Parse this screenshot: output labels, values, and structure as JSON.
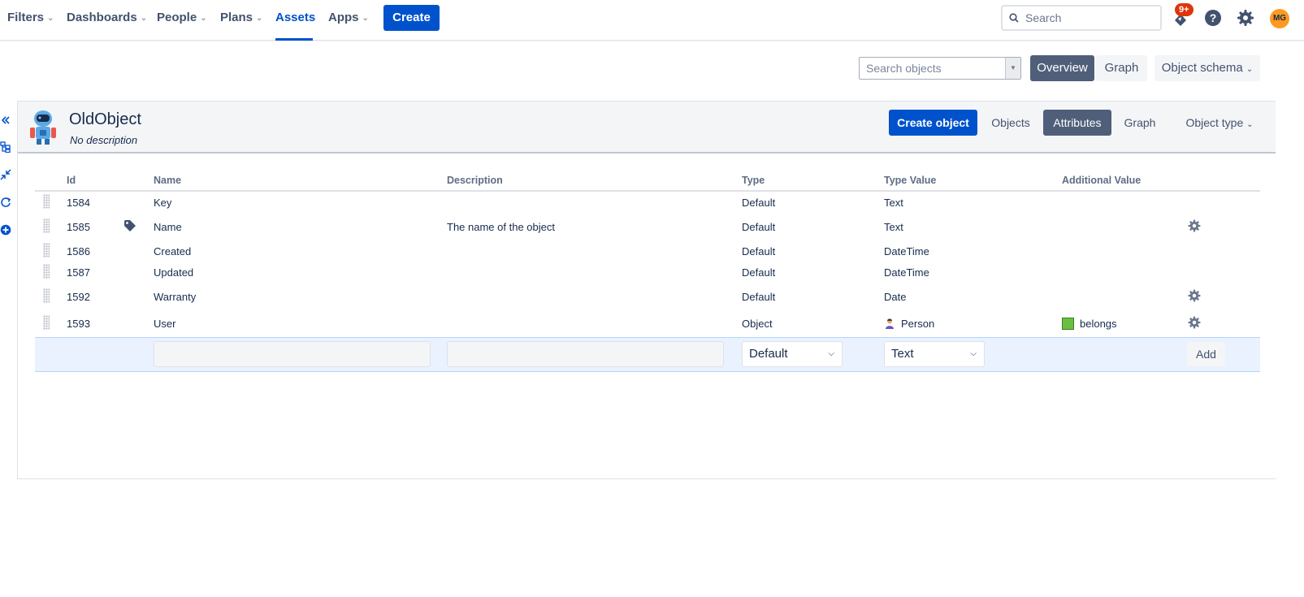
{
  "topnav": {
    "items": [
      {
        "label": "Filters"
      },
      {
        "label": "Dashboards"
      },
      {
        "label": "People"
      },
      {
        "label": "Plans"
      },
      {
        "label": "Assets"
      },
      {
        "label": "Apps"
      }
    ],
    "create_label": "Create",
    "search_placeholder": "Search",
    "notification_badge": "9+",
    "avatar_initials": "MG"
  },
  "toolbar": {
    "search_objects_placeholder": "Search objects",
    "overview_label": "Overview",
    "graph_label": "Graph",
    "object_schema_label": "Object schema"
  },
  "object": {
    "title": "OldObject",
    "description": "No description",
    "create_object_label": "Create object",
    "tabs": {
      "objects": "Objects",
      "attributes": "Attributes",
      "graph": "Graph",
      "object_type": "Object type"
    }
  },
  "table": {
    "headers": {
      "id": "Id",
      "name": "Name",
      "description": "Description",
      "type": "Type",
      "type_value": "Type Value",
      "additional_value": "Additional Value"
    },
    "rows": [
      {
        "id": "1584",
        "name": "Key",
        "description": "",
        "type": "Default",
        "type_value": "Text",
        "additional": ""
      },
      {
        "id": "1585",
        "name": "Name",
        "description": "The name of the object",
        "type": "Default",
        "type_value": "Text",
        "additional": ""
      },
      {
        "id": "1586",
        "name": "Created",
        "description": "",
        "type": "Default",
        "type_value": "DateTime",
        "additional": ""
      },
      {
        "id": "1587",
        "name": "Updated",
        "description": "",
        "type": "Default",
        "type_value": "DateTime",
        "additional": ""
      },
      {
        "id": "1592",
        "name": "Warranty",
        "description": "",
        "type": "Default",
        "type_value": "Date",
        "additional": ""
      },
      {
        "id": "1593",
        "name": "User",
        "description": "",
        "type": "Object",
        "type_value": "Person",
        "additional": "belongs"
      }
    ],
    "add_row": {
      "type_select": "Default",
      "type_value_select": "Text",
      "add_label": "Add"
    }
  },
  "colors": {
    "brand": "#0052cc",
    "selected_segment": "#505f79",
    "additional_swatch": "#6abf40"
  }
}
